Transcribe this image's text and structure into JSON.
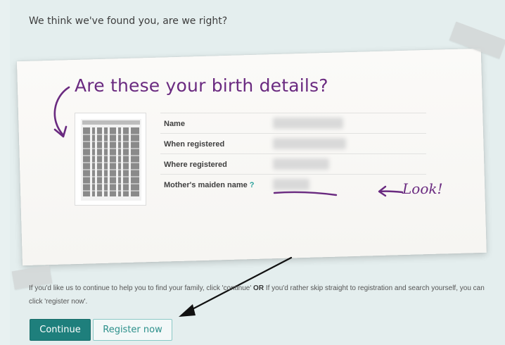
{
  "page": {
    "heading": "We think we've found you, are we right?"
  },
  "card": {
    "title": "Are these your birth details?",
    "rows": [
      {
        "label": "Name",
        "help": ""
      },
      {
        "label": "When registered",
        "help": ""
      },
      {
        "label": "Where registered",
        "help": ""
      },
      {
        "label": "Mother's maiden name",
        "help": "?"
      }
    ],
    "annotation": "Look!"
  },
  "help": {
    "text_before": "If you'd like us to continue to help you to find your family, click 'continue'",
    "or": "OR",
    "text_after": "If you'd rather skip straight to registration and search yourself, you can click 'register now'."
  },
  "actions": {
    "continue_label": "Continue",
    "register_label": "Register now"
  },
  "colors": {
    "accent_purple": "#6a2a80",
    "primary_teal": "#1e7f7c",
    "help_teal": "#2aa19b"
  }
}
